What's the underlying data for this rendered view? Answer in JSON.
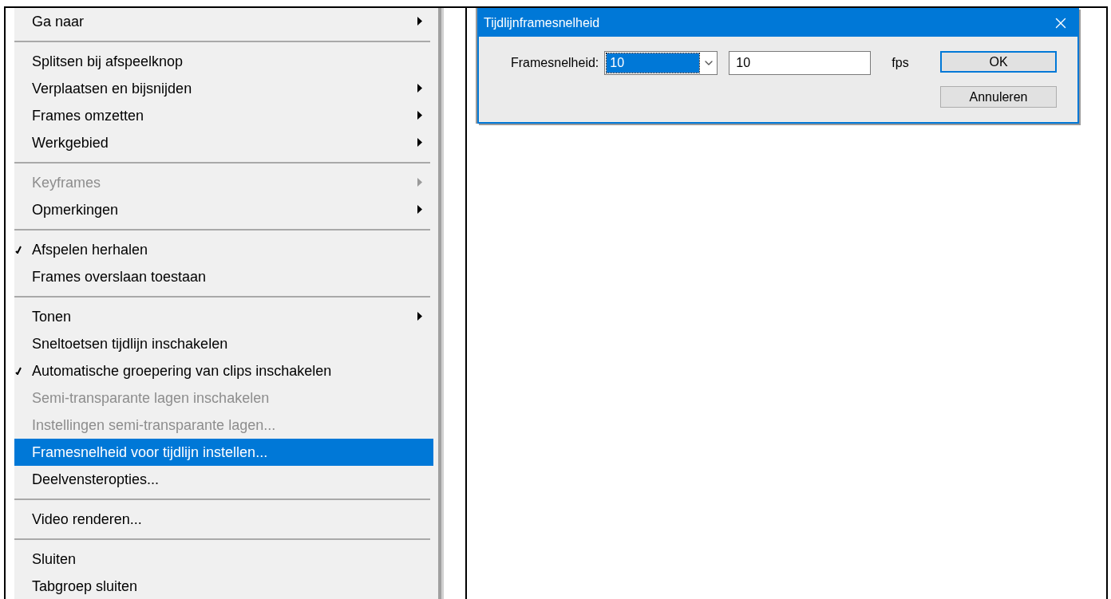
{
  "menu": {
    "items": [
      {
        "kind": "item",
        "label": "Ga naar",
        "submenu": true,
        "checked": false,
        "disabled": false,
        "selected": false
      },
      {
        "kind": "separator"
      },
      {
        "kind": "item",
        "label": "Splitsen bij afspeelknop",
        "submenu": false,
        "checked": false,
        "disabled": false,
        "selected": false
      },
      {
        "kind": "item",
        "label": "Verplaatsen en bijsnijden",
        "submenu": true,
        "checked": false,
        "disabled": false,
        "selected": false
      },
      {
        "kind": "item",
        "label": "Frames omzetten",
        "submenu": true,
        "checked": false,
        "disabled": false,
        "selected": false
      },
      {
        "kind": "item",
        "label": "Werkgebied",
        "submenu": true,
        "checked": false,
        "disabled": false,
        "selected": false
      },
      {
        "kind": "separator"
      },
      {
        "kind": "item",
        "label": "Keyframes",
        "submenu": true,
        "checked": false,
        "disabled": true,
        "selected": false
      },
      {
        "kind": "item",
        "label": "Opmerkingen",
        "submenu": true,
        "checked": false,
        "disabled": false,
        "selected": false
      },
      {
        "kind": "separator"
      },
      {
        "kind": "item",
        "label": "Afspelen herhalen",
        "submenu": false,
        "checked": true,
        "disabled": false,
        "selected": false
      },
      {
        "kind": "item",
        "label": "Frames overslaan toestaan",
        "submenu": false,
        "checked": false,
        "disabled": false,
        "selected": false
      },
      {
        "kind": "separator"
      },
      {
        "kind": "item",
        "label": "Tonen",
        "submenu": true,
        "checked": false,
        "disabled": false,
        "selected": false
      },
      {
        "kind": "item",
        "label": "Sneltoetsen tijdlijn inschakelen",
        "submenu": false,
        "checked": false,
        "disabled": false,
        "selected": false
      },
      {
        "kind": "item",
        "label": "Automatische groepering van clips inschakelen",
        "submenu": false,
        "checked": true,
        "disabled": false,
        "selected": false
      },
      {
        "kind": "item",
        "label": "Semi-transparante lagen inschakelen",
        "submenu": false,
        "checked": false,
        "disabled": true,
        "selected": false
      },
      {
        "kind": "item",
        "label": "Instellingen semi-transparante lagen...",
        "submenu": false,
        "checked": false,
        "disabled": true,
        "selected": false
      },
      {
        "kind": "item",
        "label": "Framesnelheid voor tijdlijn instellen...",
        "submenu": false,
        "checked": false,
        "disabled": false,
        "selected": true
      },
      {
        "kind": "item",
        "label": "Deelvensteropties...",
        "submenu": false,
        "checked": false,
        "disabled": false,
        "selected": false
      },
      {
        "kind": "separator"
      },
      {
        "kind": "item",
        "label": "Video renderen...",
        "submenu": false,
        "checked": false,
        "disabled": false,
        "selected": false
      },
      {
        "kind": "separator"
      },
      {
        "kind": "item",
        "label": "Sluiten",
        "submenu": false,
        "checked": false,
        "disabled": false,
        "selected": false
      },
      {
        "kind": "item",
        "label": "Tabgroep sluiten",
        "submenu": false,
        "checked": false,
        "disabled": false,
        "selected": false
      }
    ]
  },
  "dialog": {
    "title": "Tijdlijnframesnelheid",
    "label": "Framesnelheid:",
    "preset": "10",
    "value": "10",
    "unit": "fps",
    "buttons": [
      {
        "label": "OK",
        "default": true
      },
      {
        "label": "Annuleren",
        "default": false
      }
    ]
  }
}
